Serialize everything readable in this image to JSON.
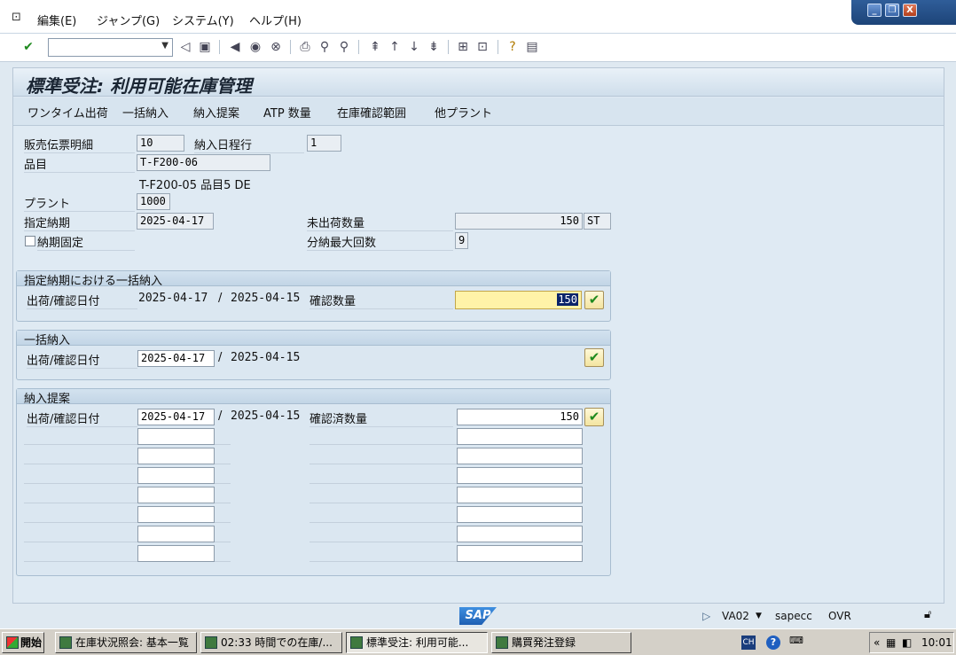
{
  "menu": {
    "items": [
      "編集(E)",
      "ジャンプ(G)",
      "システム(Y)",
      "ヘルプ(H)"
    ]
  },
  "window_controls": {
    "minimize": "_",
    "restore": "❐",
    "close": "X"
  },
  "toolbar": {
    "command_field_value": "",
    "icons": [
      "enter-icon",
      "back-icon",
      "save-icon",
      "back-nav-icon",
      "exit-icon",
      "cancel-icon",
      "print-icon",
      "find-icon",
      "find-next-icon",
      "first-page-icon",
      "prev-page-icon",
      "next-page-icon",
      "last-page-icon",
      "create-session-icon",
      "shortcut-icon",
      "help-icon",
      "layout-icon"
    ]
  },
  "screen": {
    "title": "標準受注: 利用可能在庫管理",
    "app_buttons": [
      "ワンタイム出荷",
      "一括納入",
      "納入提案",
      "ATP 数量",
      "在庫確認範囲",
      "他プラント"
    ]
  },
  "header": {
    "item_label": "販売伝票明細",
    "item_value": "10",
    "schedule_label": "納入日程行",
    "schedule_value": "1",
    "material_label": "品目",
    "material_value": "T-F200-06",
    "material_desc": "T-F200-05  品目5 DE",
    "plant_label": "プラント",
    "plant_value": "1000",
    "req_date_label": "指定納期",
    "req_date_value": "2025-04-17",
    "open_qty_label": "未出荷数量",
    "open_qty_value": "150",
    "open_qty_unit": "ST",
    "fixed_date_label": "納期固定",
    "fixed_date_checked": false,
    "max_partial_label": "分納最大回数",
    "max_partial_value": "9"
  },
  "group1": {
    "title": "指定納期における一括納入",
    "date_label": "出荷/確認日付",
    "delivery_date": "2025-04-17",
    "separator": "/",
    "confirm_date": "2025-04-15",
    "qty_label": "確認数量",
    "qty_value": "150"
  },
  "group2": {
    "title": "一括納入",
    "date_label": "出荷/確認日付",
    "delivery_date": "2025-04-17",
    "separator": "/",
    "confirm_date": "2025-04-15"
  },
  "group3": {
    "title": "納入提案",
    "date_label": "出荷/確認日付",
    "delivery_date": "2025-04-17",
    "separator": "/",
    "confirm_date": "2025-04-15",
    "qty_label": "確認済数量",
    "qty_value": "150",
    "empty_rows": 7
  },
  "statusbar": {
    "logo": "SAP",
    "transaction": "VA02",
    "server": "sapecc",
    "mode": "OVR"
  },
  "taskbar": {
    "start": "開始",
    "tasks": [
      "在庫状況照会: 基本一覧",
      "02:33 時間での在庫/...",
      "標準受注: 利用可能...",
      "購買発注登録"
    ],
    "active_task": 2,
    "lang": "CH",
    "time": "10:01"
  },
  "colors": {
    "accent": "#1e5fb3",
    "highlight_field": "#fff3a8",
    "ok_green": "#1f8a1f"
  }
}
